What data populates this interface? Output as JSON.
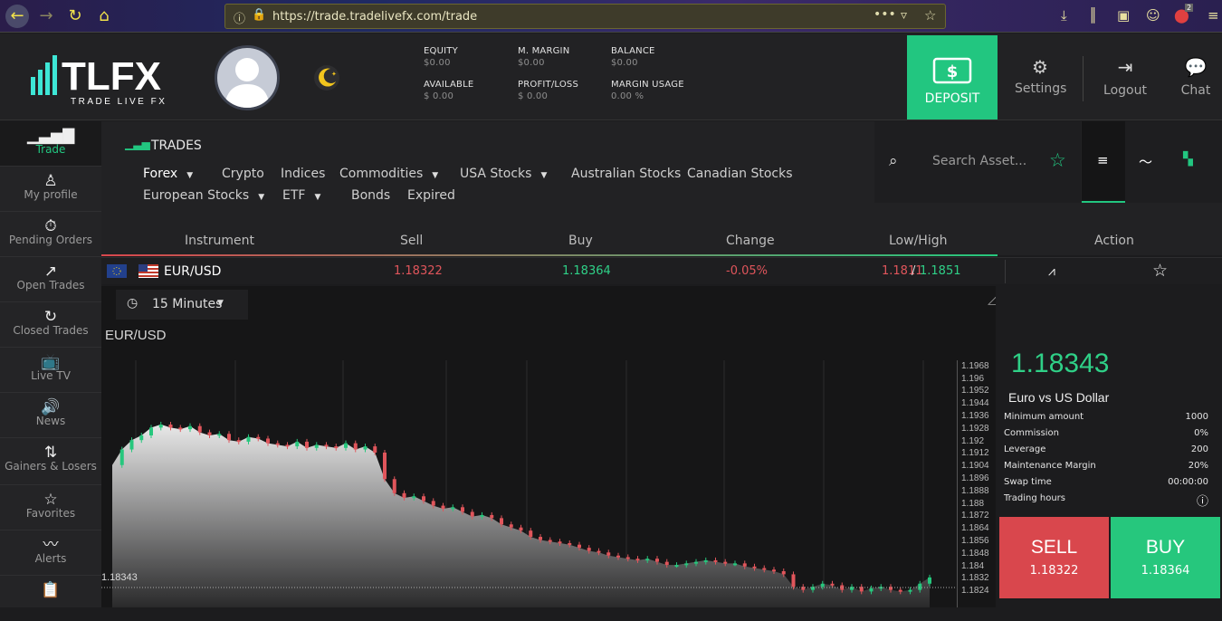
{
  "browser": {
    "url": "https://trade.tradelivefx.com/trade",
    "tab_count": "2"
  },
  "logo": {
    "brand": "TLFX",
    "tagline": "TRADE LIVE FX"
  },
  "stats": [
    {
      "label": "EQUITY",
      "value": "$0.00"
    },
    {
      "label": "M. MARGIN",
      "value": "$0.00"
    },
    {
      "label": "BALANCE",
      "value": "$0.00"
    },
    {
      "label": "AVAILABLE",
      "value": "$ 0.00"
    },
    {
      "label": "PROFIT/LOSS",
      "value": "$ 0.00"
    },
    {
      "label": "MARGIN USAGE",
      "value": "0.00 %"
    }
  ],
  "header": {
    "deposit": "DEPOSIT",
    "settings": "Settings",
    "logout": "Logout",
    "chat": "Chat"
  },
  "sidebar": [
    {
      "label": "Trade",
      "icon": "trade-icon"
    },
    {
      "label": "My profile",
      "icon": "user-icon"
    },
    {
      "label": "Pending Orders",
      "icon": "timer-icon"
    },
    {
      "label": "Open Trades",
      "icon": "open-trades-icon"
    },
    {
      "label": "Closed Trades",
      "icon": "closed-trades-icon"
    },
    {
      "label": "Live TV",
      "icon": "tv-icon"
    },
    {
      "label": "News",
      "icon": "speaker-icon"
    },
    {
      "label": "Gainers & Losers",
      "icon": "gainers-losers-icon"
    },
    {
      "label": "Favorites",
      "icon": "star-icon"
    },
    {
      "label": "Alerts",
      "icon": "alerts-icon"
    },
    {
      "label": "",
      "icon": "history-icon"
    }
  ],
  "trades": {
    "title": "TRADES",
    "search_placeholder": "Search Asset...",
    "categories": [
      "Forex",
      "Crypto",
      "Indices",
      "Commodities",
      "USA Stocks",
      "Australian Stocks",
      "Canadian Stocks",
      "European Stocks",
      "ETF",
      "Bonds",
      "Expired"
    ]
  },
  "table": {
    "headers": [
      "Instrument",
      "Sell",
      "Buy",
      "Change",
      "Low/High",
      "Action"
    ],
    "row": {
      "instrument": "EUR/USD",
      "sell": "1.18322",
      "buy": "1.18364",
      "change": "-0.05%",
      "low": "1.1811",
      "sep": "/",
      "high": "1.1851"
    }
  },
  "chart": {
    "timeframe": "15 Minutes",
    "pair": "EUR/USD",
    "current": "1.18343"
  },
  "chart_data": {
    "type": "line",
    "y_ticks": [
      "1.1968",
      "1.196",
      "1.1952",
      "1.1944",
      "1.1936",
      "1.1928",
      "1.192",
      "1.1912",
      "1.1904",
      "1.1896",
      "1.1888",
      "1.188",
      "1.1872",
      "1.1864",
      "1.1856",
      "1.1848",
      "1.184",
      "1.1832",
      "1.1824"
    ],
    "ylim": [
      1.182,
      1.1972
    ],
    "values": [
      1.1906,
      1.1916,
      1.1922,
      1.1925,
      1.193,
      1.1932,
      1.193,
      1.1929,
      1.1931,
      1.1927,
      1.1925,
      1.1926,
      1.1922,
      1.1921,
      1.1924,
      1.1923,
      1.192,
      1.1919,
      1.1918,
      1.1921,
      1.1917,
      1.1919,
      1.1918,
      1.1917,
      1.192,
      1.1916,
      1.1918,
      1.1914,
      1.1897,
      1.1888,
      1.1885,
      1.1886,
      1.1883,
      1.188,
      1.1878,
      1.1879,
      1.1876,
      1.1873,
      1.1874,
      1.1872,
      1.1868,
      1.1866,
      1.1864,
      1.186,
      1.1858,
      1.1857,
      1.1856,
      1.1855,
      1.1853,
      1.1851,
      1.185,
      1.1848,
      1.1847,
      1.1846,
      1.1845,
      1.1846,
      1.1844,
      1.1842,
      1.1842,
      1.1843,
      1.1844,
      1.1845,
      1.1844,
      1.1843,
      1.1843,
      1.1841,
      1.184,
      1.1839,
      1.1838,
      1.1836,
      1.1828,
      1.1826,
      1.1828,
      1.183,
      1.1829,
      1.1826,
      1.1828,
      1.1825,
      1.1827,
      1.1828,
      1.1826,
      1.1825,
      1.1826,
      1.183,
      1.1834
    ]
  },
  "info": {
    "price": "1.18343",
    "name": "Euro vs US Dollar",
    "rows": [
      {
        "k": "Minimum amount",
        "v": "1000"
      },
      {
        "k": "Commission",
        "v": "0%"
      },
      {
        "k": "Leverage",
        "v": "200"
      },
      {
        "k": "Maintenance Margin",
        "v": "20%"
      },
      {
        "k": "Swap time",
        "v": "00:00:00"
      },
      {
        "k": "Trading hours",
        "v": ""
      }
    ],
    "sell_label": "SELL",
    "sell_price": "1.18322",
    "buy_label": "BUY",
    "buy_price": "1.18364"
  },
  "colors": {
    "green": "#26c77d",
    "red": "#d9474d",
    "accent": "#22c680"
  }
}
